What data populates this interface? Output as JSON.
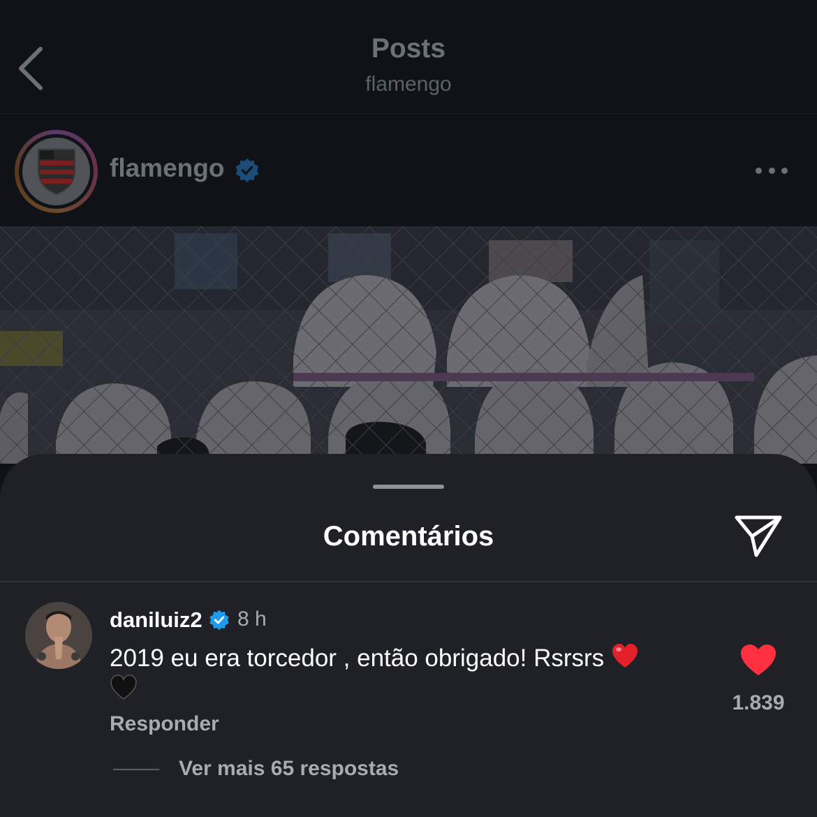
{
  "header": {
    "title": "Posts",
    "subtitle": "flamengo"
  },
  "post": {
    "username": "flamengo",
    "verified": true
  },
  "comments_sheet": {
    "title": "Comentários",
    "comment": {
      "username": "daniluiz2",
      "verified": true,
      "time": "8 h",
      "text": "2019 eu era torcedor , então obrigado! Rsrsrs",
      "emojis": [
        "red-heart-emoji",
        "black-heart-emoji"
      ],
      "reply_label": "Responder",
      "like_count": "1.839",
      "liked": true,
      "view_replies_label": "Ver mais 65 respostas"
    }
  },
  "colors": {
    "background": "#0f1318",
    "sheet": "#1f2127",
    "verified_blue": "#1d9bf0",
    "like_red": "#ff3040",
    "muted_text": "#a8abb0"
  }
}
